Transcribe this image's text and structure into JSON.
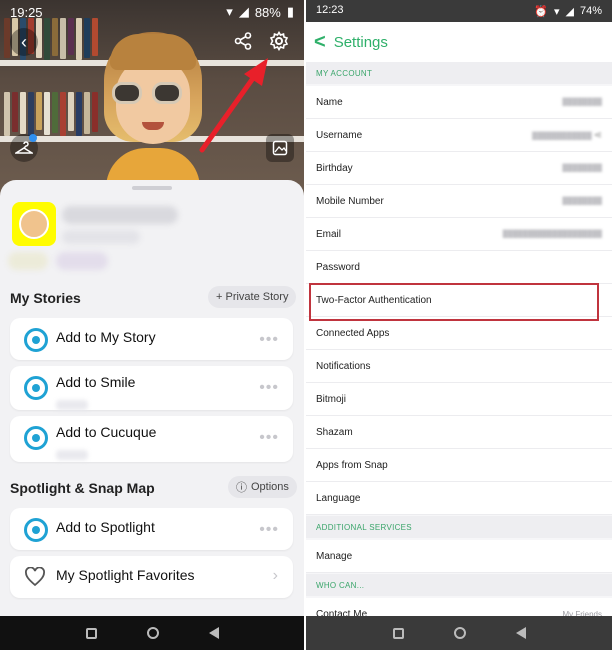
{
  "left": {
    "status": {
      "time": "19:25",
      "battery": "88%"
    },
    "profile": {
      "section_stories": "My Stories",
      "private_story_label": "+ Private Story",
      "story_items": [
        {
          "label": "Add to My Story"
        },
        {
          "label": "Add to Smile"
        },
        {
          "label": "Add to Cucuque"
        }
      ],
      "section_spotlight": "Spotlight & Snap Map",
      "options_label": "Options",
      "spotlight_items": [
        {
          "label": "Add to Spotlight"
        },
        {
          "label": "My Spotlight Favorites"
        }
      ]
    },
    "icons": [
      "back-icon",
      "share-icon",
      "gear-icon",
      "hanger-icon",
      "image-icon",
      "camera-icon",
      "heart-icon",
      "chevron-right-icon"
    ],
    "colors": {
      "snapcode": "#fffc00",
      "accent": "#1fa2d4",
      "arrow": "#e8202a"
    }
  },
  "right": {
    "status": {
      "time": "12:23",
      "battery": "74%"
    },
    "header": {
      "back": "<",
      "title": "Settings"
    },
    "sections": {
      "my_account": "MY ACCOUNT",
      "additional": "ADDITIONAL SERVICES",
      "who_can": "WHO CAN..."
    },
    "rows": [
      {
        "label": "Name"
      },
      {
        "label": "Username"
      },
      {
        "label": "Birthday"
      },
      {
        "label": "Mobile Number"
      },
      {
        "label": "Email"
      },
      {
        "label": "Password"
      },
      {
        "label": "Two-Factor Authentication"
      },
      {
        "label": "Connected Apps"
      },
      {
        "label": "Notifications"
      },
      {
        "label": "Bitmoji"
      },
      {
        "label": "Shazam"
      },
      {
        "label": "Apps from Snap"
      },
      {
        "label": "Language"
      }
    ],
    "manage": "Manage",
    "contact_me": {
      "label": "Contact Me",
      "value": "My Friends"
    },
    "colors": {
      "accent": "#2fb06a",
      "highlight": "#c0343e"
    }
  }
}
